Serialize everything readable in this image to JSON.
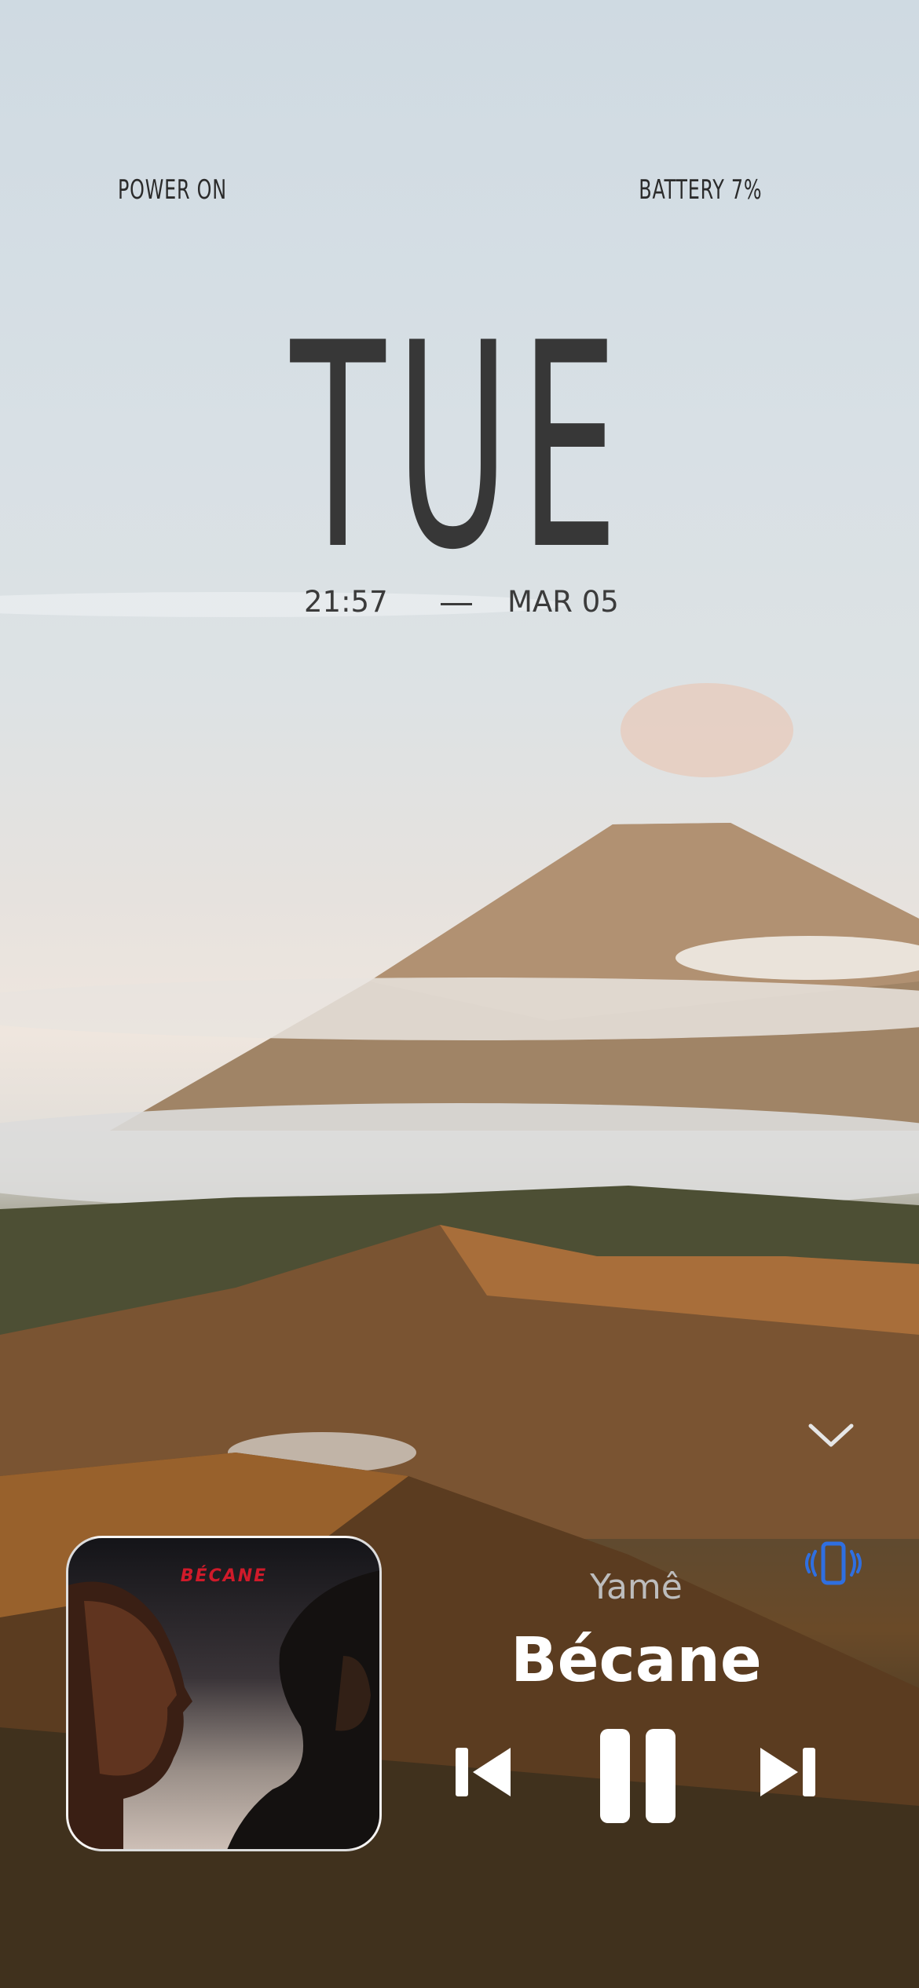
{
  "status": {
    "left": "POWER ON",
    "right": "BATTERY 7%"
  },
  "clock": {
    "day": "TUE",
    "time": "21:57",
    "date": "MAR 05"
  },
  "now_playing": {
    "album_art_text": "BÉCANE",
    "artist": "Yamê",
    "track": "Bécane",
    "accent_color": "#2f6fe0"
  },
  "icons": {
    "collapse": "chevron-down-icon",
    "output": "phone-vibrate-icon",
    "previous": "skip-back-icon",
    "pause": "pause-icon",
    "next": "skip-forward-icon"
  }
}
